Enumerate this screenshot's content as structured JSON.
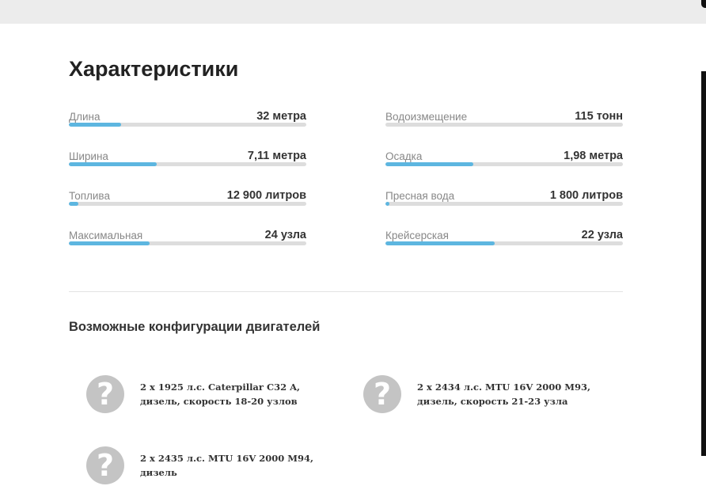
{
  "specs": {
    "title": "Характеристики",
    "left": [
      {
        "label": "Длина",
        "value": "32 метра",
        "level": 0.22
      },
      {
        "label": "Ширина",
        "value": "7,11 метра",
        "level": 0.37
      },
      {
        "label": "Топлива",
        "value": "12 900 литров",
        "level": 0.04
      },
      {
        "label": "Максимальная",
        "value": "24 узла",
        "level": 0.34
      }
    ],
    "right": [
      {
        "label": "Водоизмещение",
        "value": "115 тонн",
        "level": 0.0
      },
      {
        "label": "Осадка",
        "value": "1,98 метра",
        "level": 0.37
      },
      {
        "label": "Пресная вода",
        "value": "1 800 литров",
        "level": 0.015
      },
      {
        "label": "Крейсерская",
        "value": "22 узла",
        "level": 0.46
      }
    ],
    "accent_color": "#5db6e0",
    "track_color": "#dddddd"
  },
  "engines": {
    "title": "Возможные конфигурации двигателей",
    "items": [
      {
        "icon": "question-icon",
        "text": "2 x 1925 л.с. Caterpillar C32 A, дизель, скорость 18-20 узлов"
      },
      {
        "icon": "question-icon",
        "text": "2 x 2434 л.с. MTU 16V 2000 M93, дизель, скорость 21-23 узла"
      },
      {
        "icon": "question-icon",
        "text": "2 x 2435 л.с. MTU 16V 2000 M94, дизель"
      }
    ]
  }
}
